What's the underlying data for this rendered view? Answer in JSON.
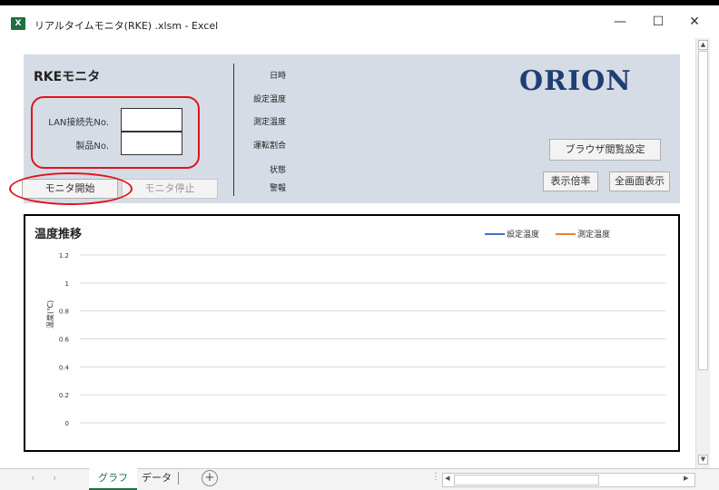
{
  "window": {
    "title": "リアルタイムモニタ(RKE) .xlsm - Excel",
    "app_icon": "X",
    "minimize": "—",
    "maximize": "☐",
    "close": "✕"
  },
  "monitor": {
    "title": "RKEモニタ",
    "lan_label": "LAN接続先No.",
    "lan_value": "",
    "product_label": "製品No.",
    "product_value": "",
    "start_button": "モニタ開始",
    "stop_button": "モニタ停止",
    "status_labels": [
      "日時",
      "設定温度",
      "測定温度",
      "運転割合",
      "状態",
      "警報"
    ],
    "logo": "ORION",
    "browser_button": "ブラウザ閲覧設定",
    "zoom_button": "表示倍率",
    "fullscreen_button": "全画面表示"
  },
  "chart_data": {
    "type": "line",
    "title": "温度推移",
    "ylabel": "温度(℃)",
    "xlabel": "",
    "yticks": [
      1.2,
      1,
      0.8,
      0.6,
      0.4,
      0.2,
      0
    ],
    "ylim": [
      0,
      1.2
    ],
    "grid": true,
    "legend": "top-right",
    "series": [
      {
        "name": "設定温度",
        "color": "#4472c4",
        "values": []
      },
      {
        "name": "測定温度",
        "color": "#ed7d31",
        "values": []
      }
    ]
  },
  "tabs": {
    "items": [
      "グラフ",
      "データ"
    ],
    "active": "グラフ",
    "add_sheet": "+"
  },
  "icons": {
    "scroll_up": "up-arrow-icon",
    "scroll_down": "down-arrow-icon",
    "scroll_left": "left-arrow-icon",
    "scroll_right": "right-arrow-icon"
  },
  "colors": {
    "panel": "#d6dce5",
    "highlight": "#e0141b",
    "logo": "#1f3f73",
    "excel_green": "#1d6f42"
  }
}
